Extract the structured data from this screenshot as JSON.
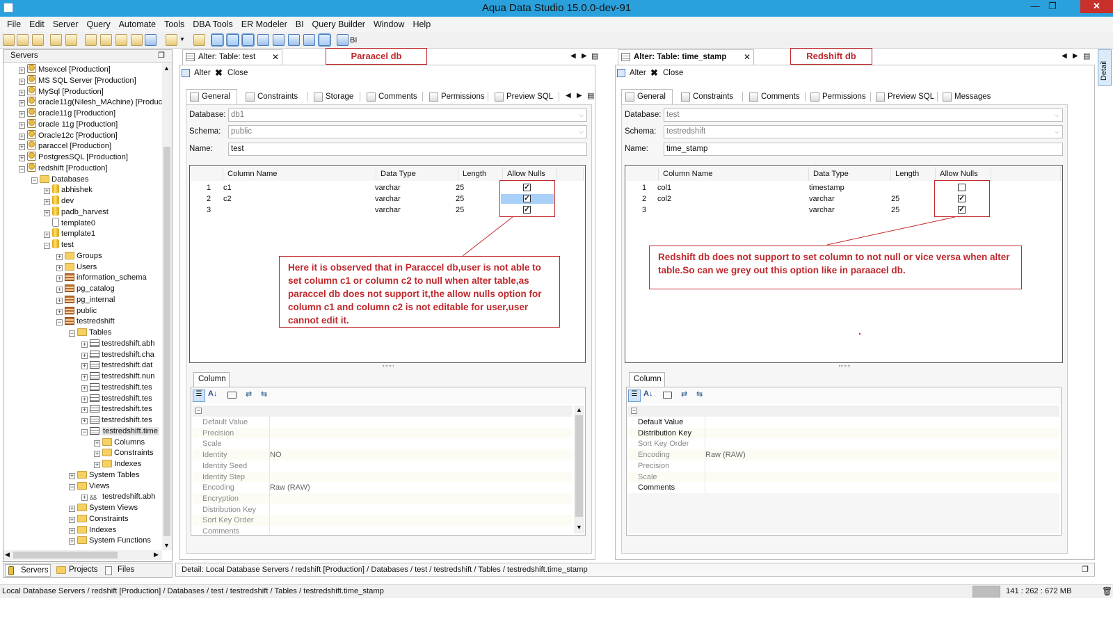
{
  "window": {
    "title": "Aqua Data Studio 15.0.0-dev-91"
  },
  "menu": [
    "File",
    "Edit",
    "Server",
    "Query",
    "Automate",
    "Tools",
    "DBA Tools",
    "ER Modeler",
    "BI",
    "Query Builder",
    "Window",
    "Help"
  ],
  "toolbar": {
    "bi_label": "BI"
  },
  "servers_panel": {
    "title": "Servers",
    "tree": [
      {
        "label": "Msexcel [Production]",
        "level": 0,
        "icon": "server"
      },
      {
        "label": "MS SQL Server [Production]",
        "level": 0,
        "icon": "server"
      },
      {
        "label": "MySql [Production]",
        "level": 0,
        "icon": "server"
      },
      {
        "label": "oracle11g(Nilesh_MAchine) [Product",
        "level": 0,
        "icon": "server"
      },
      {
        "label": "oracle11g [Production]",
        "level": 0,
        "icon": "server"
      },
      {
        "label": "oracle 11g [Production]",
        "level": 0,
        "icon": "server"
      },
      {
        "label": "Oracle12c [Production]",
        "level": 0,
        "icon": "server"
      },
      {
        "label": "paraccel [Production]",
        "level": 0,
        "icon": "server"
      },
      {
        "label": "PostgresSQL [Production]",
        "level": 0,
        "icon": "server"
      },
      {
        "label": "redshift [Production]",
        "level": 0,
        "icon": "server",
        "open": true
      },
      {
        "label": "Databases",
        "level": 1,
        "icon": "folder",
        "open": true
      },
      {
        "label": "abhishek",
        "level": 2,
        "icon": "db"
      },
      {
        "label": "dev",
        "level": 2,
        "icon": "db"
      },
      {
        "label": "padb_harvest",
        "level": 2,
        "icon": "db"
      },
      {
        "label": "template0",
        "level": 2,
        "icon": "dbw",
        "leaf": true
      },
      {
        "label": "template1",
        "level": 2,
        "icon": "db"
      },
      {
        "label": "test",
        "level": 2,
        "icon": "db",
        "open": true
      },
      {
        "label": "Groups",
        "level": 3,
        "icon": "folder"
      },
      {
        "label": "Users",
        "level": 3,
        "icon": "folder"
      },
      {
        "label": "information_schema",
        "level": 3,
        "icon": "schema"
      },
      {
        "label": "pg_catalog",
        "level": 3,
        "icon": "schema"
      },
      {
        "label": "pg_internal",
        "level": 3,
        "icon": "schema"
      },
      {
        "label": "public",
        "level": 3,
        "icon": "schema"
      },
      {
        "label": "testredshift",
        "level": 3,
        "icon": "schema",
        "open": true
      },
      {
        "label": "Tables",
        "level": 4,
        "icon": "folder",
        "open": true
      },
      {
        "label": "testredshift.abh",
        "level": 5,
        "icon": "table"
      },
      {
        "label": "testredshift.cha",
        "level": 5,
        "icon": "table"
      },
      {
        "label": "testredshift.dat",
        "level": 5,
        "icon": "table"
      },
      {
        "label": "testredshift.nun",
        "level": 5,
        "icon": "table"
      },
      {
        "label": "testredshift.tes",
        "level": 5,
        "icon": "table"
      },
      {
        "label": "testredshift.tes",
        "level": 5,
        "icon": "table"
      },
      {
        "label": "testredshift.tes",
        "level": 5,
        "icon": "table"
      },
      {
        "label": "testredshift.tes",
        "level": 5,
        "icon": "table"
      },
      {
        "label": "testredshift.time",
        "level": 5,
        "icon": "table",
        "open": true,
        "selected": true
      },
      {
        "label": "Columns",
        "level": 6,
        "icon": "folder"
      },
      {
        "label": "Constraints",
        "level": 6,
        "icon": "folder"
      },
      {
        "label": "Indexes",
        "level": 6,
        "icon": "folder"
      },
      {
        "label": "System Tables",
        "level": 4,
        "icon": "folder"
      },
      {
        "label": "Views",
        "level": 4,
        "icon": "folder",
        "open": true
      },
      {
        "label": "testredshift.abh",
        "level": 5,
        "icon": "view"
      },
      {
        "label": "System Views",
        "level": 4,
        "icon": "folder"
      },
      {
        "label": "Constraints",
        "level": 4,
        "icon": "folder"
      },
      {
        "label": "Indexes",
        "level": 4,
        "icon": "folder"
      },
      {
        "label": "System Functions",
        "level": 4,
        "icon": "folder"
      }
    ],
    "bottom_tabs": [
      "Servers",
      "Projects",
      "Files"
    ]
  },
  "left_editor": {
    "tab_title": "Alter: Table: test",
    "label": "Paraacel db",
    "alter_label": "Alter",
    "close_label": "Close",
    "inner_tabs": [
      "General",
      "Constraints",
      "Storage",
      "Comments",
      "Permissions",
      "Preview SQL"
    ],
    "database_label": "Database:",
    "database_value": "db1",
    "schema_label": "Schema:",
    "schema_value": "public",
    "name_label": "Name:",
    "name_value": "test",
    "grid_headers": [
      "Column Name",
      "Data Type",
      "Length",
      "Allow Nulls"
    ],
    "rows": [
      {
        "n": "1",
        "name": "c1",
        "type": "varchar",
        "len": "25",
        "nulls": true
      },
      {
        "n": "2",
        "name": "c2",
        "type": "varchar",
        "len": "25",
        "nulls": true
      },
      {
        "n": "3",
        "name": "",
        "type": "varchar",
        "len": "25",
        "nulls": true
      }
    ],
    "note": "Here it is observed that in Paraccel db,user is not able to set column c1 or column c2 to null when alter table,as paraccel db does not support it,the allow nulls option for column c1 and column c2 is not editable for user,user cannot edit it.",
    "column_tab": "Column",
    "properties": [
      {
        "k": "Default Value",
        "v": ""
      },
      {
        "k": "Precision",
        "v": ""
      },
      {
        "k": "Scale",
        "v": ""
      },
      {
        "k": "Identity",
        "v": "NO"
      },
      {
        "k": "Identity Seed",
        "v": ""
      },
      {
        "k": "Identity Step",
        "v": ""
      },
      {
        "k": "Encoding",
        "v": "Raw (RAW)"
      },
      {
        "k": "Encryption",
        "v": ""
      },
      {
        "k": "Distribution Key",
        "v": ""
      },
      {
        "k": "Sort Key Order",
        "v": ""
      },
      {
        "k": "Comments",
        "v": ""
      }
    ]
  },
  "right_editor": {
    "tab_title": "Alter: Table: time_stamp",
    "label": "Redshift db",
    "alter_label": "Alter",
    "close_label": "Close",
    "inner_tabs": [
      "General",
      "Constraints",
      "Comments",
      "Permissions",
      "Preview SQL",
      "Messages"
    ],
    "database_label": "Database:",
    "database_value": "test",
    "schema_label": "Schema:",
    "schema_value": "testredshift",
    "name_label": "Name:",
    "name_value": "time_stamp",
    "grid_headers": [
      "Column Name",
      "Data Type",
      "Length",
      "Allow Nulls"
    ],
    "rows": [
      {
        "n": "1",
        "name": "col1",
        "type": "timestamp",
        "len": "",
        "nulls": false
      },
      {
        "n": "2",
        "name": "col2",
        "type": "varchar",
        "len": "25",
        "nulls": true
      },
      {
        "n": "3",
        "name": "",
        "type": "varchar",
        "len": "25",
        "nulls": true
      }
    ],
    "note": "Redshift db does not support to set column to not null or vice versa when alter table.So can we grey out this option like in paraacel db.",
    "column_tab": "Column",
    "properties": [
      {
        "k": "Default Value",
        "v": "",
        "active": true
      },
      {
        "k": "Distribution Key",
        "v": "",
        "active": true
      },
      {
        "k": "Sort Key Order",
        "v": ""
      },
      {
        "k": "Encoding",
        "v": "Raw (RAW)"
      },
      {
        "k": "Precision",
        "v": ""
      },
      {
        "k": "Scale",
        "v": ""
      },
      {
        "k": "Comments",
        "v": "",
        "active": true
      }
    ]
  },
  "detail_bar": "Detail: Local Database Servers / redshift [Production] / Databases / test / testredshift / Tables / testredshift.time_stamp",
  "status_bar": {
    "path": "Local Database Servers / redshift [Production] / Databases / test / testredshift / Tables / testredshift.time_stamp",
    "memory": "141 : 262 : 672 MB"
  },
  "side_tab": "Detail"
}
